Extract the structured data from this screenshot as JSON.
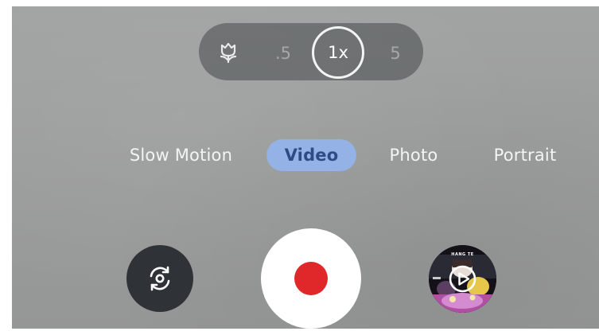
{
  "zoom": {
    "macro_icon": "tulip-macro-icon",
    "options": [
      ".5",
      "1x",
      "5"
    ],
    "selected": "1x"
  },
  "modes": {
    "items": [
      "Slow Motion",
      "Video",
      "Photo",
      "Portrait"
    ],
    "selected": "Video"
  },
  "controls": {
    "flip_icon": "camera-flip-icon",
    "shutter_icon": "record-dot-icon",
    "gallery_icon": "play-icon",
    "gallery_caption": "HANG TE"
  },
  "colors": {
    "record": "#e0282a",
    "mode_highlight": "#94b2e6",
    "mode_highlight_text": "#2e4b86"
  }
}
